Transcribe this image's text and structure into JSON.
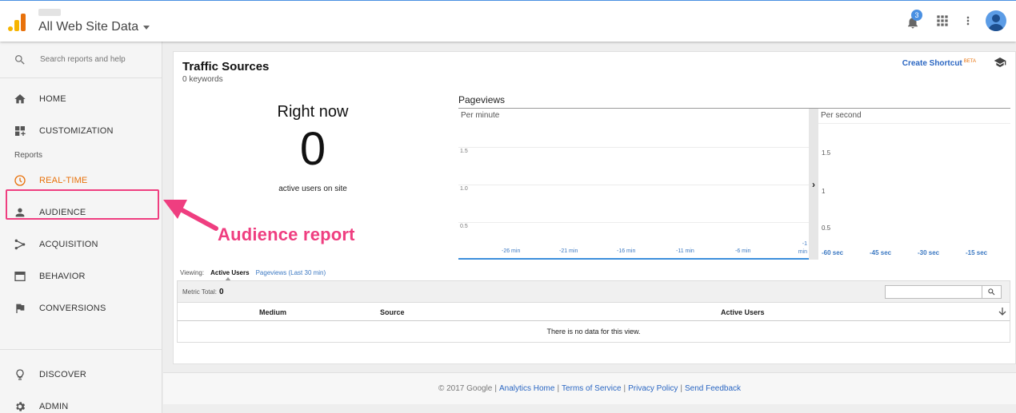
{
  "header": {
    "property_label": "All Web Site Data",
    "notification_count": "3"
  },
  "sidebar": {
    "search_placeholder": "Search reports and help",
    "items_top": [
      {
        "label": "HOME",
        "icon": "home-icon"
      },
      {
        "label": "CUSTOMIZATION",
        "icon": "dashboard-icon"
      }
    ],
    "reports_label": "Reports",
    "reports": [
      {
        "label": "REAL-TIME",
        "icon": "clock-icon",
        "active": true
      },
      {
        "label": "AUDIENCE",
        "icon": "person-icon"
      },
      {
        "label": "ACQUISITION",
        "icon": "acquisition-icon"
      },
      {
        "label": "BEHAVIOR",
        "icon": "behavior-icon"
      },
      {
        "label": "CONVERSIONS",
        "icon": "flag-icon"
      }
    ],
    "items_bottom": [
      {
        "label": "DISCOVER",
        "icon": "lightbulb-icon"
      },
      {
        "label": "ADMIN",
        "icon": "gear-icon"
      }
    ]
  },
  "annotation": {
    "label": "Audience report",
    "color": "#ef3e80"
  },
  "main": {
    "title": "Traffic Sources",
    "subtitle": "0 keywords",
    "shortcut_label": "Create Shortcut",
    "beta_label": "BETA",
    "right_now_label": "Right now",
    "active_users_value": "0",
    "active_users_label": "active users on site",
    "pageviews_title": "Pageviews",
    "per_minute_label": "Per minute",
    "per_second_label": "Per second",
    "per_minute_yticks": [
      "1.5",
      "1.0",
      "0.5"
    ],
    "per_minute_xticks": [
      "-26 min",
      "-21 min",
      "-16 min",
      "-11 min",
      "-6 min",
      "-1 min"
    ],
    "per_second_yticks": [
      "1.5",
      "1",
      "0.5"
    ],
    "per_second_xticks": [
      "-60 sec",
      "-45 sec",
      "-30 sec",
      "-15 sec"
    ],
    "viewing_label": "Viewing:",
    "viewing_active": "Active Users",
    "viewing_link": "Pageviews (Last 30 min)",
    "metric_total_label": "Metric Total:",
    "metric_total_value": "0",
    "columns": [
      "Medium",
      "Source",
      "Active Users"
    ],
    "empty_message": "There is no data for this view."
  },
  "footer": {
    "copyright": "© 2017 Google",
    "links": [
      "Analytics Home",
      "Terms of Service",
      "Privacy Policy",
      "Send Feedback"
    ]
  },
  "colors": {
    "accent_orange": "#e8710a",
    "link_blue": "#2a66c2",
    "top_border_blue": "#4a90e2"
  }
}
